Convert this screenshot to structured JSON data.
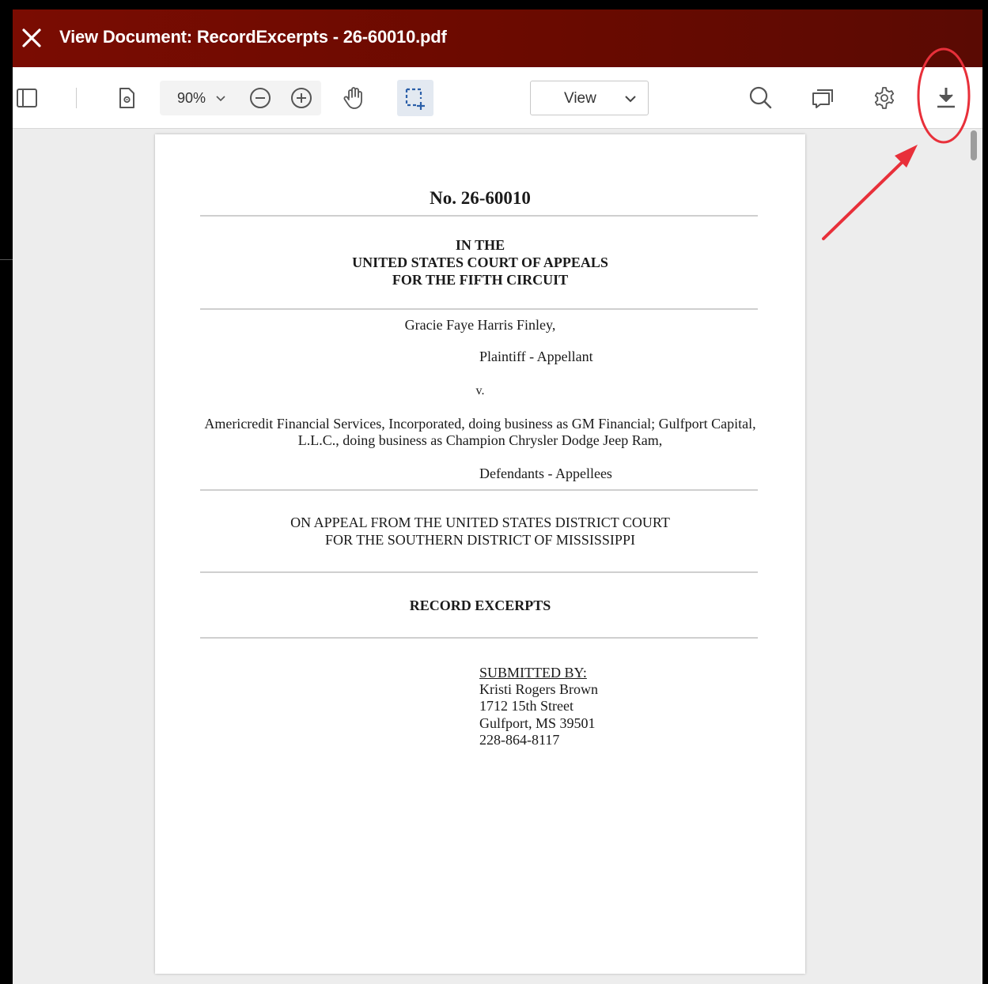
{
  "window": {
    "title": "View Document: RecordExcerpts - 26-60010.pdf"
  },
  "toolbar": {
    "zoom_value": "90%",
    "view_mode": "View",
    "icons": [
      "sidebar-toggle-icon",
      "page-settings-icon",
      "zoom-out-icon",
      "zoom-in-icon",
      "pan-hand-icon",
      "marquee-select-icon",
      "search-icon",
      "comments-icon",
      "settings-gear-icon",
      "download-icon"
    ]
  },
  "document": {
    "case_number": "No. 26-60010",
    "court_line1": "IN THE",
    "court_line2": "UNITED STATES COURT OF APPEALS",
    "court_line3": "FOR THE FIFTH CIRCUIT",
    "plaintiff_name": "Gracie Faye Harris Finley,",
    "plaintiff_role": "Plaintiff - Appellant",
    "versus": "v.",
    "defendants_line1": "Americredit Financial Services, Incorporated, doing business as GM Financial; Gulfport Capital,",
    "defendants_line2": "L.L.C., doing business as Champion Chrysler Dodge Jeep Ram,",
    "defendants_role": "Defendants - Appellees",
    "appeal_line1": "ON APPEAL FROM THE UNITED STATES DISTRICT COURT",
    "appeal_line2": "FOR THE SOUTHERN DISTRICT OF MISSISSIPPI",
    "doc_title": "RECORD EXCERPTS",
    "submitted_by_label": "SUBMITTED BY:",
    "submitter_name": "Kristi Rogers Brown",
    "submitter_street": "1712 15th Street",
    "submitter_city": "Gulfport, MS 39501",
    "submitter_phone": "228-864-8117"
  },
  "annotation": {
    "color": "#e8303a",
    "target": "download-icon"
  }
}
